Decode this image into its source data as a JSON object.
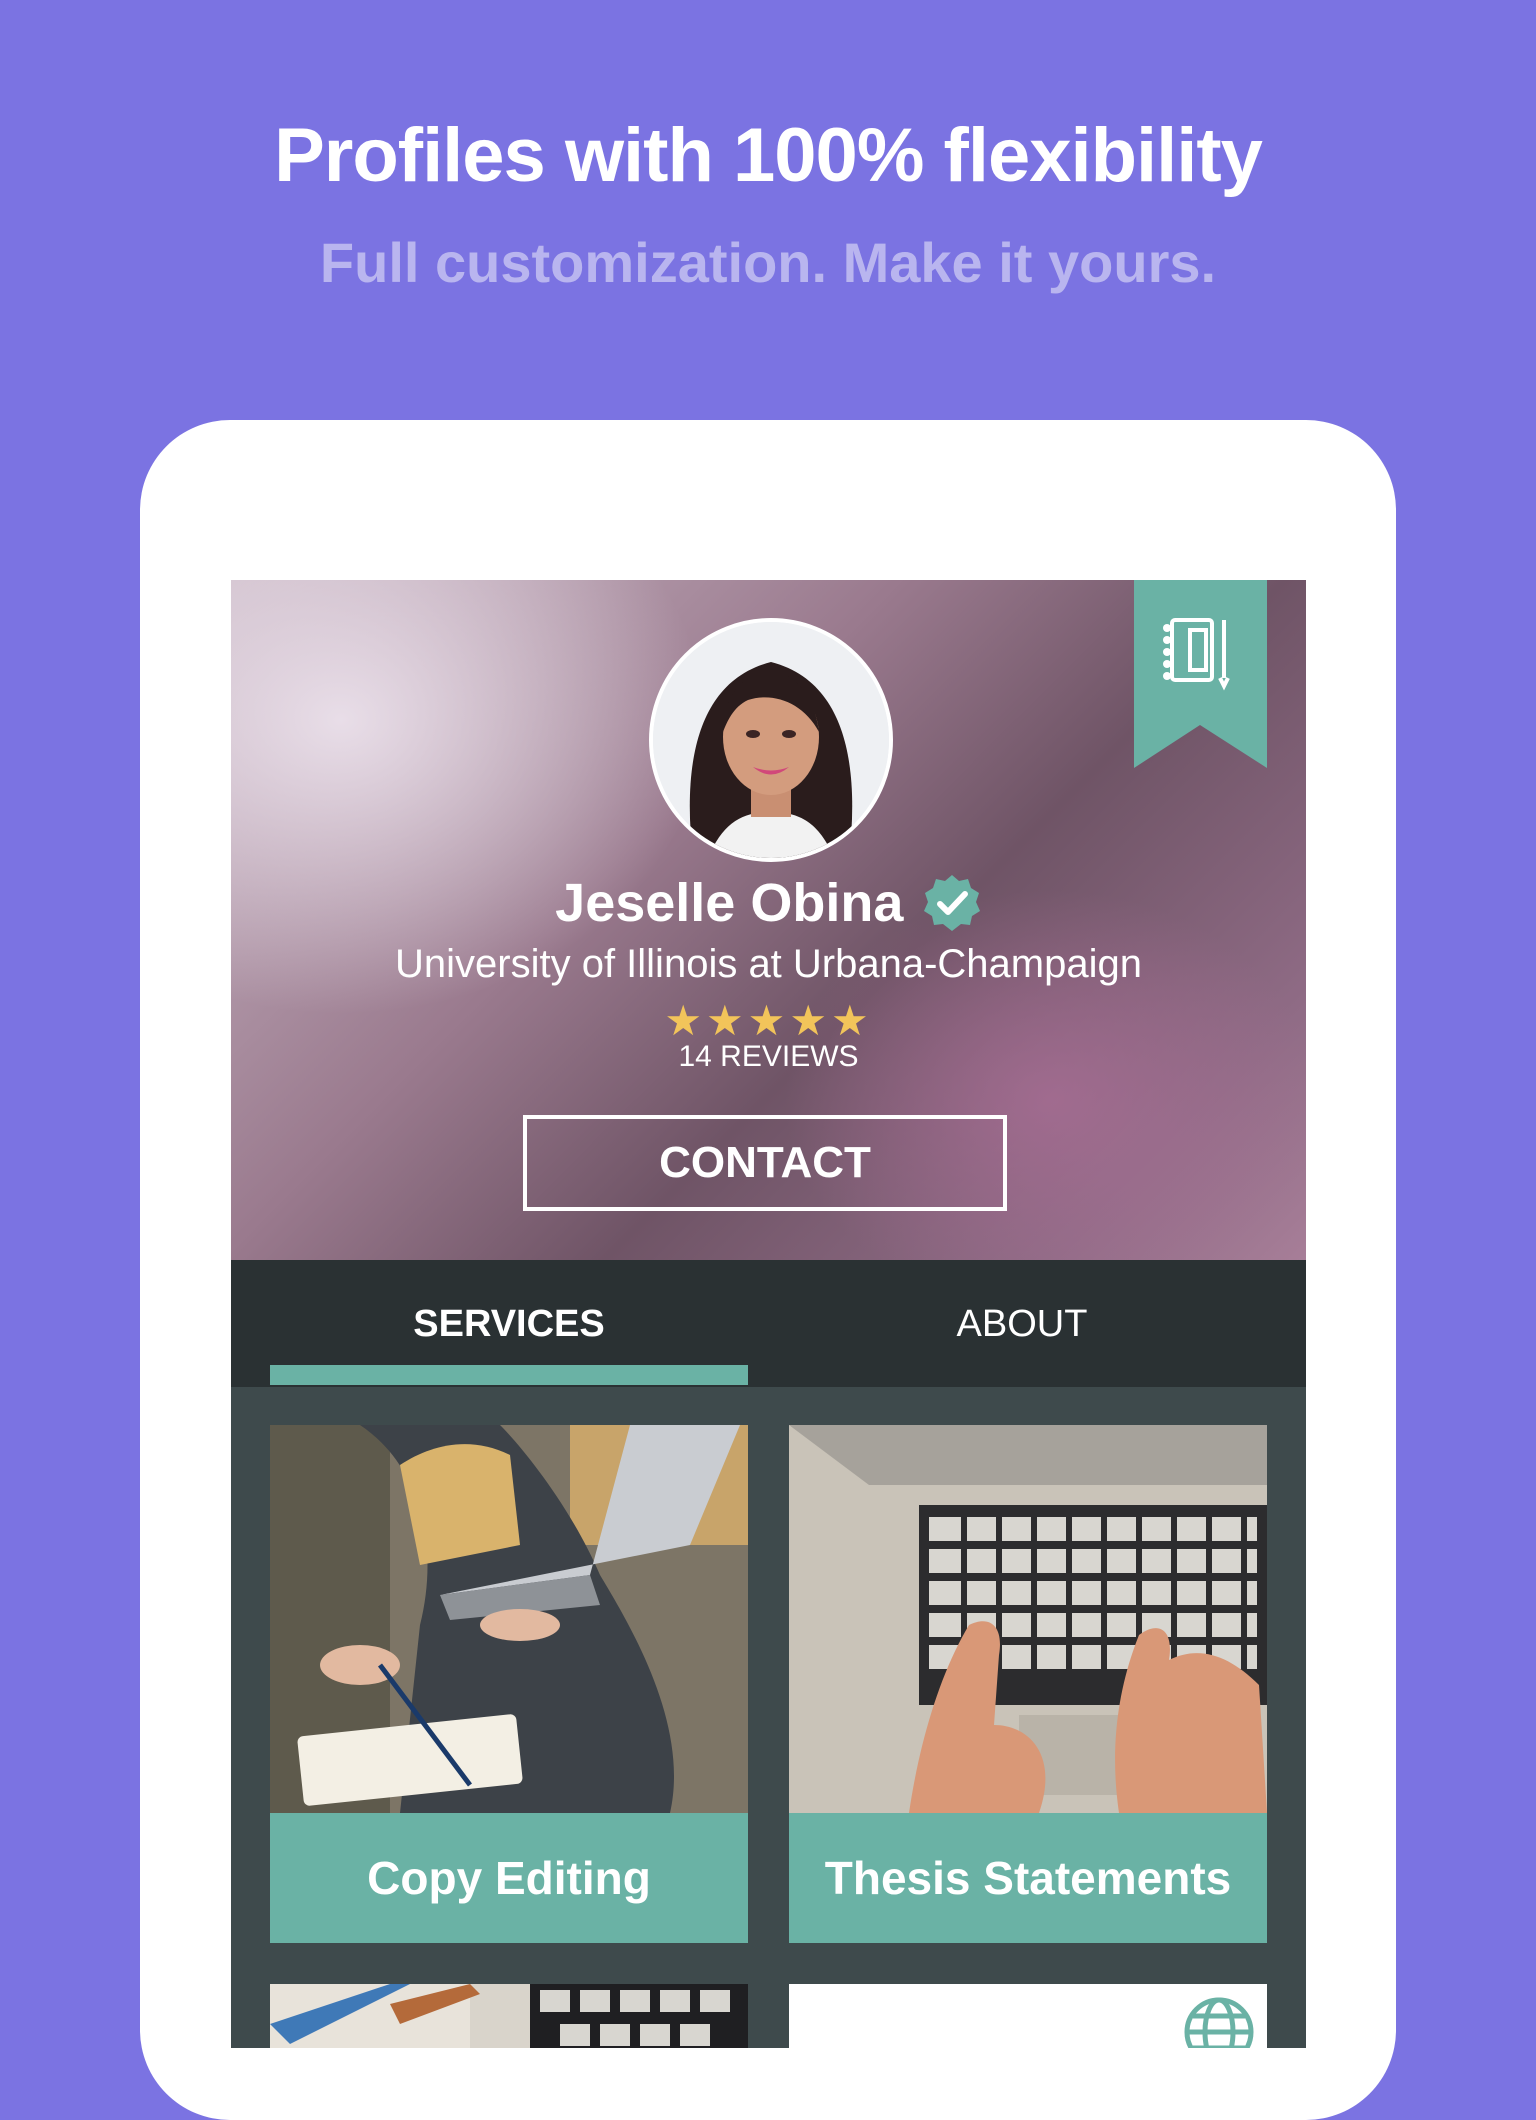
{
  "promo": {
    "headline": "Profiles with 100% flexibility",
    "subheadline": "Full customization. Make it yours."
  },
  "profile": {
    "name": "Jeselle Obina",
    "school": "University of Illinois at Urbana-Champaign",
    "rating": 5,
    "stars_text": "★★★★★",
    "reviews": "14 REVIEWS",
    "contact_label": "CONTACT"
  },
  "tabs": [
    {
      "label": "SERVICES",
      "active": true
    },
    {
      "label": "ABOUT",
      "active": false
    }
  ],
  "services": [
    {
      "label": "Copy Editing"
    },
    {
      "label": "Thesis Statements"
    }
  ],
  "colors": {
    "background": "#7b73e2",
    "accent": "#6ab2a5",
    "tab_bar": "#2a3133",
    "star": "#f2c45a"
  }
}
